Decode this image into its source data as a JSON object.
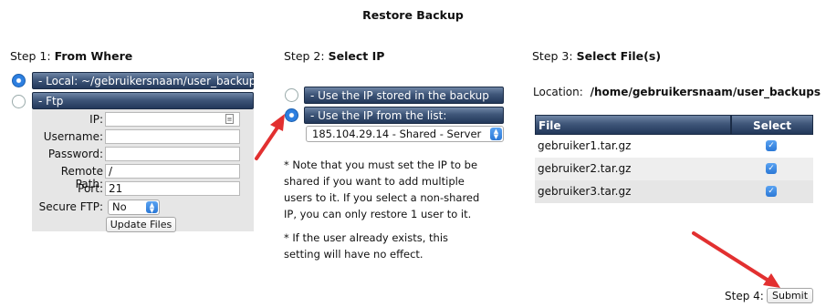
{
  "title": "Restore Backup",
  "step1": {
    "label_prefix": "Step 1:",
    "label_bold": "From Where",
    "option_local": "- Local: ~/gebruikersnaam/user_backups/",
    "option_ftp": "- Ftp",
    "fields": {
      "ip_label": "IP:",
      "ip_value": "",
      "username_label": "Username:",
      "username_value": "",
      "password_label": "Password:",
      "password_value": "",
      "remote_path_label": "Remote Path:",
      "remote_path_value": "/",
      "port_label": "Port:",
      "port_value": "21",
      "secure_ftp_label": "Secure FTP:",
      "secure_ftp_value": "No"
    },
    "update_button": "Update Files"
  },
  "step2": {
    "label_prefix": "Step 2:",
    "label_bold": "Select IP",
    "option_stored": "- Use the IP stored in the backup",
    "option_list": "- Use the IP from the list:",
    "ip_select_value": "185.104.29.14 - Shared - Server",
    "note1_line1": "* Note that you must set the IP to be",
    "note1_line2": "shared if you want to add multiple",
    "note1_line3": "users to it. If you select a non-shared",
    "note1_line4": "IP, you can only restore 1 user to it.",
    "note2_line1": "* If the user already exists, this",
    "note2_line2": "setting will have no effect."
  },
  "step3": {
    "label_prefix": "Step 3:",
    "label_bold": "Select File(s)",
    "location_label": "Location:",
    "location_value": "/home/gebruikersnaam/user_backups",
    "columns": [
      "File",
      "Select"
    ],
    "files": [
      "gebruiker1.tar.gz",
      "gebruiker2.tar.gz",
      "gebruiker3.tar.gz"
    ]
  },
  "step4": {
    "label": "Step 4:",
    "submit": "Submit"
  },
  "colors": {
    "bar_dark": "#22385a",
    "bar_light": "#6f86a6",
    "arrow_red": "#e23030",
    "accent_blue": "#2b78d6"
  }
}
